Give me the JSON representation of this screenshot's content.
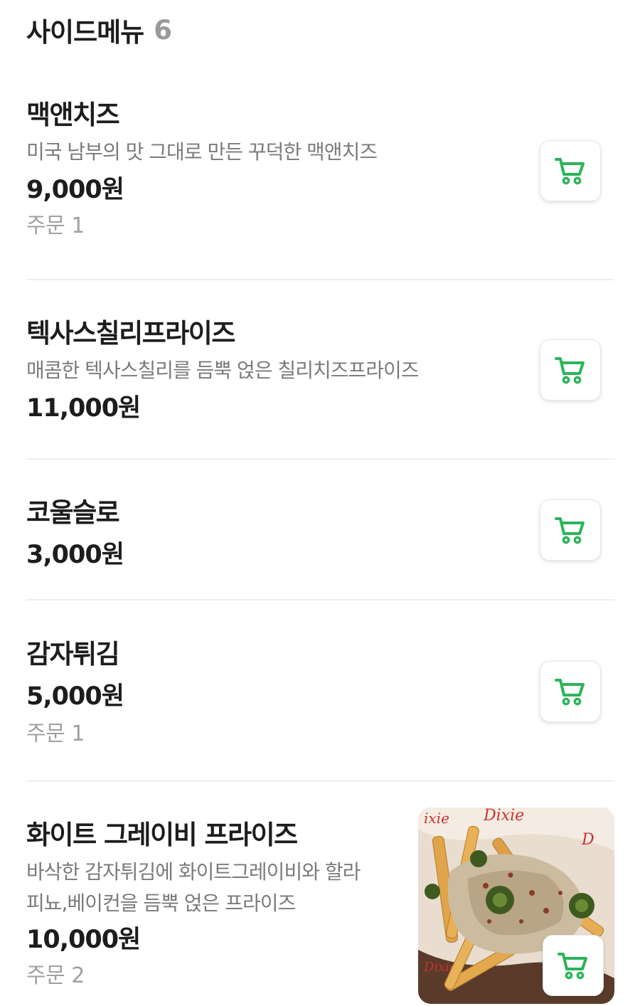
{
  "section": {
    "title": "사이드메뉴",
    "count": "6"
  },
  "items": [
    {
      "name": "맥앤치즈",
      "description": "미국 남부의 맛 그대로 만든 꾸덕한 맥앤치즈",
      "price": "9,000원",
      "orders": "주문 1"
    },
    {
      "name": "텍사스칠리프라이즈",
      "description": "매콤한 텍사스칠리를 듬뿍 얹은 칠리치즈프라이즈",
      "price": "11,000원"
    },
    {
      "name": "코울슬로",
      "price": "3,000원"
    },
    {
      "name": "감자튀김",
      "price": "5,000원",
      "orders": "주문 1"
    },
    {
      "name": "화이트 그레이비 프라이즈",
      "description_line1": "바삭한 감자튀김에 화이트그레이비와 할라",
      "description_line2": "피뇨,베이컨을 듬뿍 얹은 프라이즈",
      "price": "10,000원",
      "orders": "주문 2",
      "image": "white-gravy-fries-photo"
    }
  ],
  "icons": {
    "cart": "shopping-cart-icon"
  },
  "colors": {
    "accent": "#2bb45a",
    "text": "#1d1d1d",
    "muted": "#7b7b7b",
    "divider": "#efefef"
  }
}
